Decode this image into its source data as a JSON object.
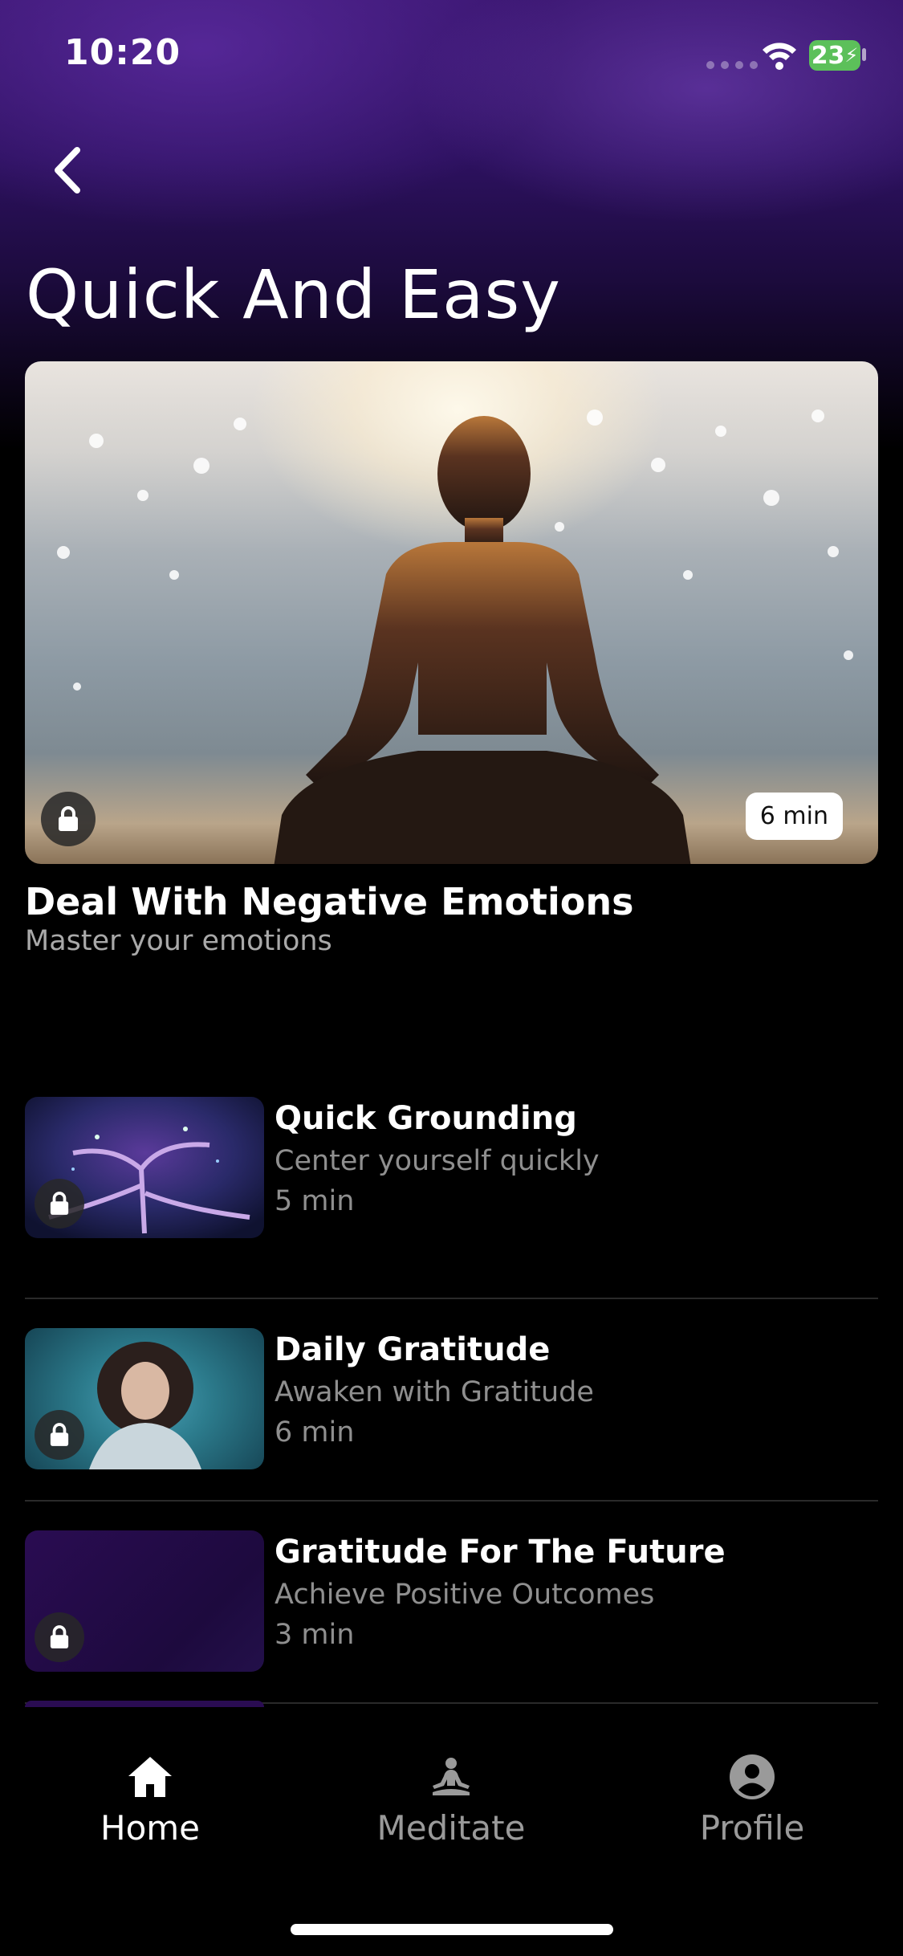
{
  "status_bar": {
    "time": "10:20",
    "battery": "23"
  },
  "header": {
    "title": "Quick And Easy",
    "back_icon": "chevron-left-icon"
  },
  "featured": {
    "title": "Deal With Negative Emotions",
    "subtitle": "Master your emotions",
    "duration": "6 min",
    "locked": true
  },
  "sessions": [
    {
      "title": "Quick Grounding",
      "subtitle": "Center yourself quickly",
      "duration": "5 min",
      "locked": true
    },
    {
      "title": "Daily Gratitude",
      "subtitle": "Awaken with Gratitude",
      "duration": "6 min",
      "locked": true
    },
    {
      "title": "Gratitude For The Future",
      "subtitle": "Achieve Positive Outcomes",
      "duration": "3 min",
      "locked": true
    }
  ],
  "tabs": [
    {
      "label": "Home",
      "icon": "home-icon",
      "active": true
    },
    {
      "label": "Meditate",
      "icon": "meditate-icon",
      "active": false
    },
    {
      "label": "Profile",
      "icon": "profile-icon",
      "active": false
    }
  ],
  "colors": {
    "background": "#000000",
    "header_gradient": "#3a1670",
    "muted_text": "#8f8f8f",
    "battery": "#5cc05a",
    "inactive_tab": "#9a9a9a"
  }
}
